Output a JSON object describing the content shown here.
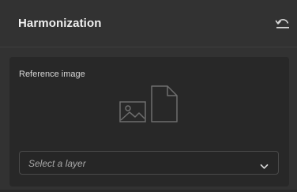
{
  "panel": {
    "title": "Harmonization",
    "reset_icon": "reset-icon"
  },
  "reference": {
    "label": "Reference image",
    "placeholder_icons": [
      "image-icon",
      "document-icon"
    ]
  },
  "layer_select": {
    "value": "Select a layer",
    "icon": "chevron-down-icon"
  },
  "colors": {
    "panel_bg": "#323232",
    "card_bg": "#282828",
    "text": "#e6e6e6",
    "muted": "#a8a8a8"
  }
}
